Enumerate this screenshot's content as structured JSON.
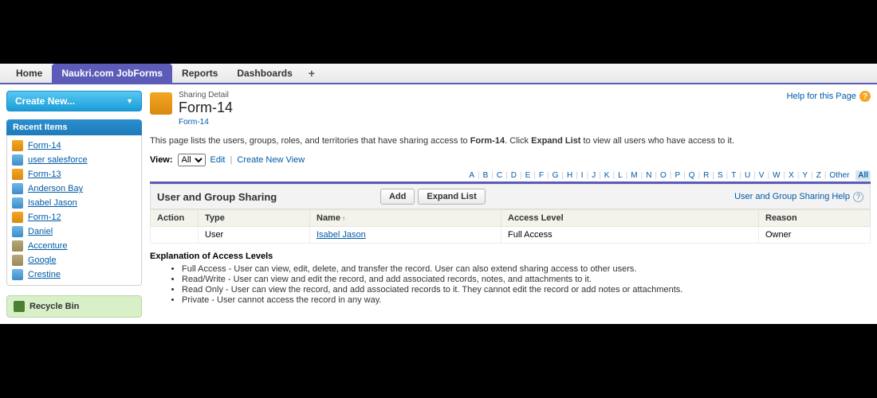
{
  "tabs": {
    "items": [
      "Home",
      "Naukri.com JobForms",
      "Reports",
      "Dashboards"
    ],
    "active_index": 1
  },
  "sidebar": {
    "create_new": "Create New...",
    "recent_header": "Recent Items",
    "recent": [
      {
        "label": "Form-14",
        "icon": "form"
      },
      {
        "label": "user salesforce",
        "icon": "user"
      },
      {
        "label": "Form-13",
        "icon": "form"
      },
      {
        "label": "Anderson Bay",
        "icon": "user"
      },
      {
        "label": "Isabel Jason",
        "icon": "user"
      },
      {
        "label": "Form-12",
        "icon": "form"
      },
      {
        "label": "Daniel",
        "icon": "user"
      },
      {
        "label": "Accenture",
        "icon": "acct"
      },
      {
        "label": "Google",
        "icon": "acct"
      },
      {
        "label": "Crestine",
        "icon": "user"
      }
    ],
    "recycle": "Recycle Bin"
  },
  "header": {
    "detail": "Sharing Detail",
    "title": "Form-14",
    "breadcrumb": "Form-14",
    "help_link": "Help for this Page"
  },
  "description": {
    "pre": "This page lists the users, groups, roles, and territories that have sharing access to ",
    "bold1": "Form-14",
    "mid": ". Click ",
    "bold2": "Expand List",
    "post": " to view all users who have access to it."
  },
  "view": {
    "label": "View:",
    "selected": "All",
    "edit": "Edit",
    "create": "Create New View"
  },
  "alpha": {
    "letters": [
      "A",
      "B",
      "C",
      "D",
      "E",
      "F",
      "G",
      "H",
      "I",
      "J",
      "K",
      "L",
      "M",
      "N",
      "O",
      "P",
      "Q",
      "R",
      "S",
      "T",
      "U",
      "V",
      "W",
      "X",
      "Y",
      "Z"
    ],
    "other": "Other",
    "all": "All",
    "selected": "All"
  },
  "panel": {
    "title": "User and Group Sharing",
    "add": "Add",
    "expand": "Expand List",
    "help": "User and Group Sharing Help",
    "columns": {
      "action": "Action",
      "type": "Type",
      "name": "Name",
      "access": "Access Level",
      "reason": "Reason"
    },
    "rows": [
      {
        "action": "",
        "type": "User",
        "name": "Isabel Jason",
        "access": "Full Access",
        "reason": "Owner"
      }
    ]
  },
  "explanation": {
    "header": "Explanation of Access Levels",
    "items": [
      "Full Access - User can view, edit, delete, and transfer the record. User can also extend sharing access to other users.",
      "Read/Write - User can view and edit the record, and add associated records, notes, and attachments to it.",
      "Read Only - User can view the record, and add associated records to it. They cannot edit the record or add notes or attachments.",
      "Private - User cannot access the record in any way."
    ]
  }
}
